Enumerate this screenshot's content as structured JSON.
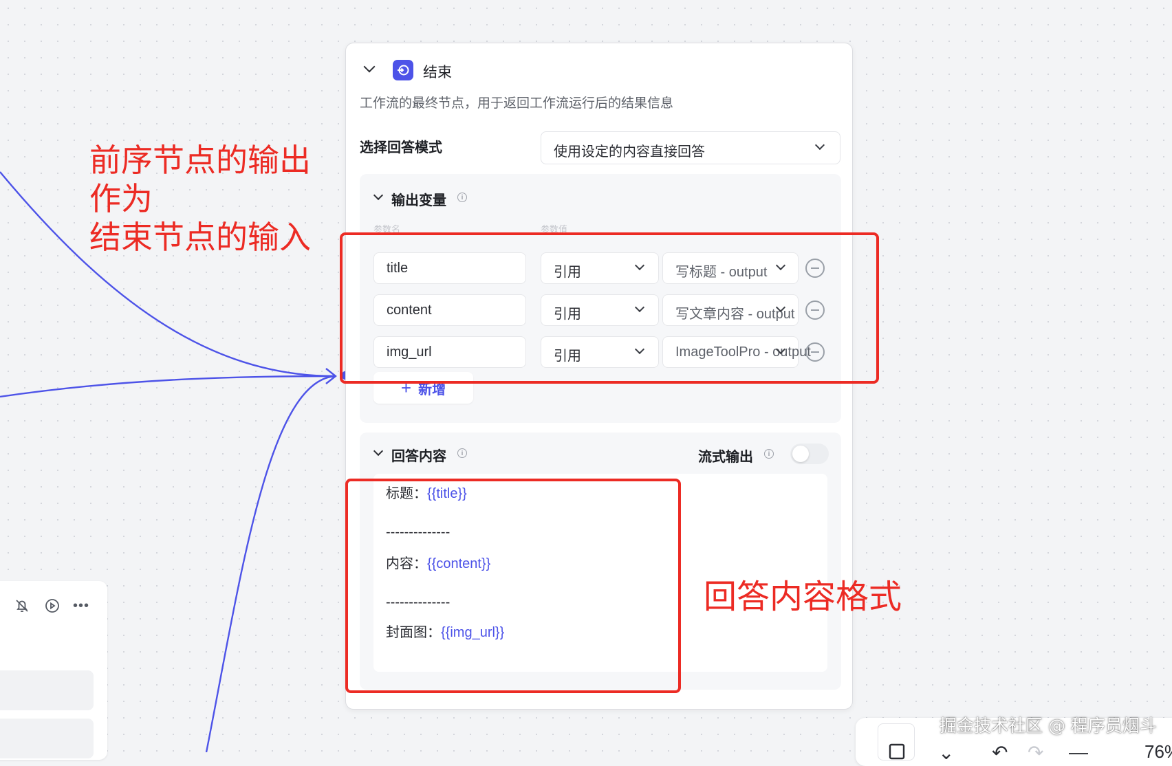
{
  "annotations": {
    "left_lines": [
      "前序节点的输出",
      "作为",
      "结束节点的输入"
    ],
    "right": "回答内容格式"
  },
  "node": {
    "title": "结束",
    "description": "工作流的最终节点，用于返回工作流运行后的结果信息",
    "answer_mode_label": "选择回答模式",
    "answer_mode_value": "使用设定的内容直接回答",
    "output_section": {
      "title": "输出变量",
      "col_name": "参数名",
      "col_value": "参数值",
      "rows": [
        {
          "name": "title",
          "ref_type": "引用",
          "value": "写标题 - output"
        },
        {
          "name": "content",
          "ref_type": "引用",
          "value": "写文章内容 - output"
        },
        {
          "name": "img_url",
          "ref_type": "引用",
          "value": "ImageToolPro - output"
        }
      ],
      "add_label": "新增"
    },
    "answer_section": {
      "title": "回答内容",
      "stream_label": "流式输出",
      "stream_on": false,
      "lines": [
        {
          "prefix": "标题：",
          "var": "{{title}}"
        },
        {
          "prefix": "--------------",
          "var": ""
        },
        {
          "prefix": "内容：",
          "var": "{{content}}"
        },
        {
          "prefix": "--------------",
          "var": ""
        },
        {
          "prefix": "封面图：",
          "var": "{{img_url}}"
        }
      ]
    }
  },
  "toolbar": {
    "zoom": "76%"
  },
  "watermark": "掘金技术社区 @ 程序员烟斗",
  "colors": {
    "accent": "#4d53e8",
    "annotation": "#ec2b24"
  }
}
